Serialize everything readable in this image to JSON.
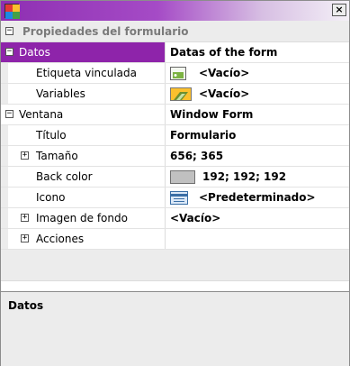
{
  "window": {
    "close_label": "×",
    "icon_colors": [
      "#e53935",
      "#fbc02d",
      "#1e88e5",
      "#43a047"
    ]
  },
  "categories": {
    "form_properties": "Propiedades del formulario"
  },
  "rows": {
    "datos": {
      "name": "Datos",
      "value": "Datas of the form"
    },
    "etiqueta": {
      "name": "Etiqueta vinculada",
      "value": "<Vacío>",
      "icon": "tag-icon"
    },
    "variables": {
      "name": "Variables",
      "value": "<Vacío>",
      "icon": "variables-icon"
    },
    "ventana": {
      "name": "Ventana",
      "value": "Window Form"
    },
    "titulo": {
      "name": "Título",
      "value": "Formulario"
    },
    "tamano": {
      "name": "Tamaño",
      "value": "656; 365"
    },
    "backcolor": {
      "name": "Back color",
      "value": "192; 192; 192",
      "color": "#c0c0c0"
    },
    "icono": {
      "name": "Icono",
      "value": "<Predeterminado>",
      "icon": "form-icon"
    },
    "imagen": {
      "name": "Imagen de fondo",
      "value": "<Vacío>"
    },
    "acciones": {
      "name": "Acciones",
      "value": ""
    }
  },
  "description": {
    "title": "Datos"
  },
  "colors": {
    "selection": "#8e24aa",
    "title_gradient_start": "#8e2fb2"
  }
}
